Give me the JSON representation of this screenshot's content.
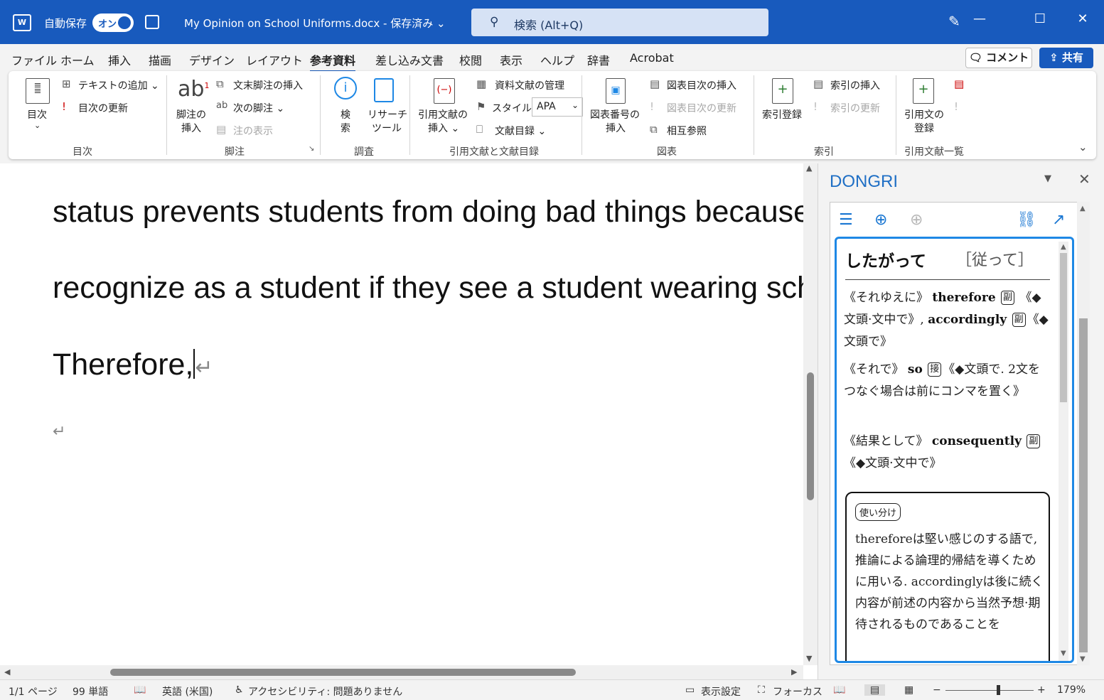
{
  "titlebar": {
    "autosave_label": "自動保存",
    "autosave_state": "オン",
    "doc_title": "My Opinion on School Uniforms.docx - 保存済み ⌄",
    "search_placeholder": "検索 (Alt+Q)",
    "min": "—",
    "restore": "☐",
    "close": "✕"
  },
  "tabs": [
    "ファイル",
    "ホーム",
    "挿入",
    "描画",
    "デザイン",
    "レイアウト",
    "参考資料",
    "差し込み文書",
    "校閲",
    "表示",
    "ヘルプ",
    "辞書",
    "Acrobat"
  ],
  "active_tab": "参考資料",
  "comment_label": "コメント",
  "share_label": "共有",
  "ribbon": {
    "toc": {
      "big": "目次",
      "add_text": "テキストの追加 ⌄",
      "update": "目次の更新",
      "group": "目次"
    },
    "footnote": {
      "big1": "脚注の",
      "big2": "挿入",
      "endnote": "文末脚注の挿入",
      "next": "次の脚注 ⌄",
      "show": "注の表示",
      "group": "脚注"
    },
    "research": {
      "search1": "検",
      "search2": "索",
      "tool1": "リサーチ",
      "tool2": "ツール",
      "group": "調査"
    },
    "citations": {
      "big1": "引用文献の",
      "big2": "挿入 ⌄",
      "manage": "資料文献の管理",
      "style_label": "スタイル:",
      "style_value": "APA",
      "biblio": "文献目録 ⌄",
      "group": "引用文献と文献目録"
    },
    "captions": {
      "big1": "図表番号の",
      "big2": "挿入",
      "insert_tof": "図表目次の挿入",
      "update_tof": "図表目次の更新",
      "cross_ref": "相互参照",
      "group": "図表"
    },
    "index": {
      "big": "索引登録",
      "insert": "索引の挿入",
      "update": "索引の更新",
      "group": "索引"
    },
    "toa": {
      "big1": "引用文の",
      "big2": "登録",
      "group": "引用文献一覧"
    }
  },
  "document": {
    "line1": "status prevents students from doing bad things because p",
    "line2": "recognize as a student if they see a student wearing scho",
    "line3": "Therefore,",
    "para_mark": "↵"
  },
  "pane": {
    "title": "DONGRI",
    "headword": "したがって",
    "kanji": "［従って］",
    "senses": [
      {
        "gloss": "《それゆえに》",
        "word": "therefore",
        "pos": "副",
        "note": "《◆文頭·文中で》,",
        "word2": "accordingly",
        "pos2": "副",
        "note2": "《◆文頭で》"
      },
      {
        "gloss": "《それで》",
        "word": "so",
        "pos": "接",
        "note": "《◆文頭で. 2文をつなぐ場合は前にコンマを置く》"
      },
      {
        "gloss": "《結果として》",
        "word": "consequently",
        "pos": "副",
        "note": "《◆文頭·文中で》"
      }
    ],
    "usage_badge": "使い分け",
    "usage_text": "thereforeは堅い感じのする語で, 推論による論理的帰結を導くために用いる. accordinglyは後に続く内容が前述の内容から当然予想·期待されるものであることを"
  },
  "status": {
    "page": "1/1 ページ",
    "words": "99 単語",
    "lang": "英語 (米国)",
    "accessibility": "アクセシビリティ: 問題ありません",
    "display_settings": "表示設定",
    "focus": "フォーカス",
    "zoom": "179%"
  },
  "colors": {
    "brand": "#185abd",
    "dongri_accent": "#1e88e5"
  }
}
